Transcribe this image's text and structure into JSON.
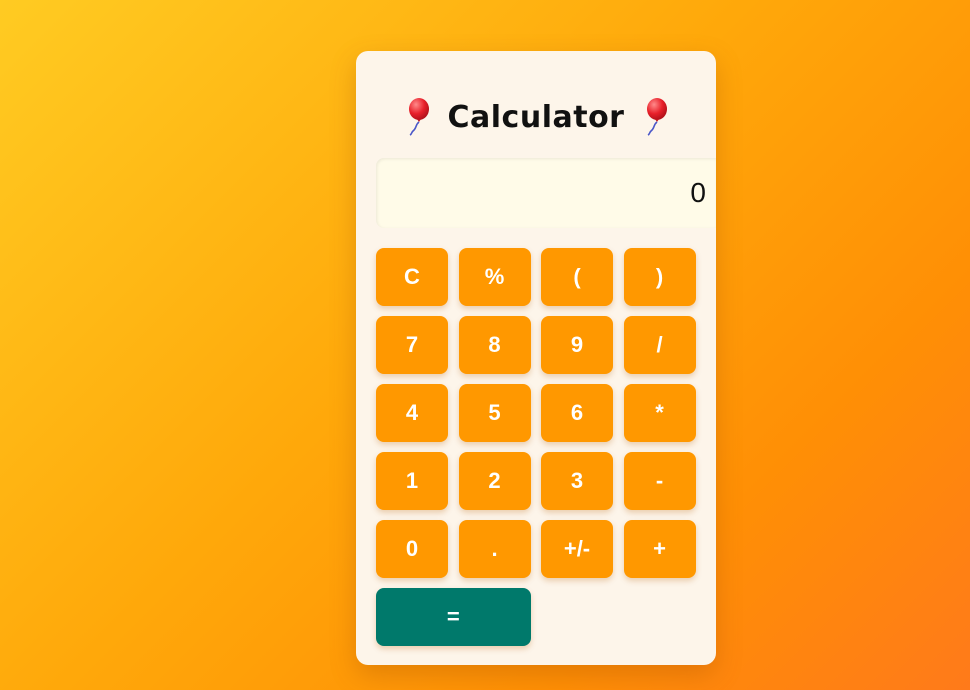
{
  "app": {
    "title": "Calculator",
    "title_icon": "balloon-icon"
  },
  "display": {
    "value": "0"
  },
  "keys": [
    {
      "id": "clear",
      "label": "C"
    },
    {
      "id": "percent",
      "label": "%"
    },
    {
      "id": "open-paren",
      "label": "("
    },
    {
      "id": "close-paren",
      "label": ")"
    },
    {
      "id": "7",
      "label": "7"
    },
    {
      "id": "8",
      "label": "8"
    },
    {
      "id": "9",
      "label": "9"
    },
    {
      "id": "divide",
      "label": "/"
    },
    {
      "id": "4",
      "label": "4"
    },
    {
      "id": "5",
      "label": "5"
    },
    {
      "id": "6",
      "label": "6"
    },
    {
      "id": "multiply",
      "label": "*"
    },
    {
      "id": "1",
      "label": "1"
    },
    {
      "id": "2",
      "label": "2"
    },
    {
      "id": "3",
      "label": "3"
    },
    {
      "id": "subtract",
      "label": "-"
    },
    {
      "id": "0",
      "label": "0"
    },
    {
      "id": "decimal",
      "label": "."
    },
    {
      "id": "negate",
      "label": "+/-"
    },
    {
      "id": "add",
      "label": "+"
    },
    {
      "id": "equals",
      "label": "="
    }
  ],
  "colors": {
    "key": "#ff9800",
    "equals_key": "#00796b",
    "card": "#fdf5ea",
    "display": "#fffbe8",
    "balloon": "#e8202a"
  }
}
